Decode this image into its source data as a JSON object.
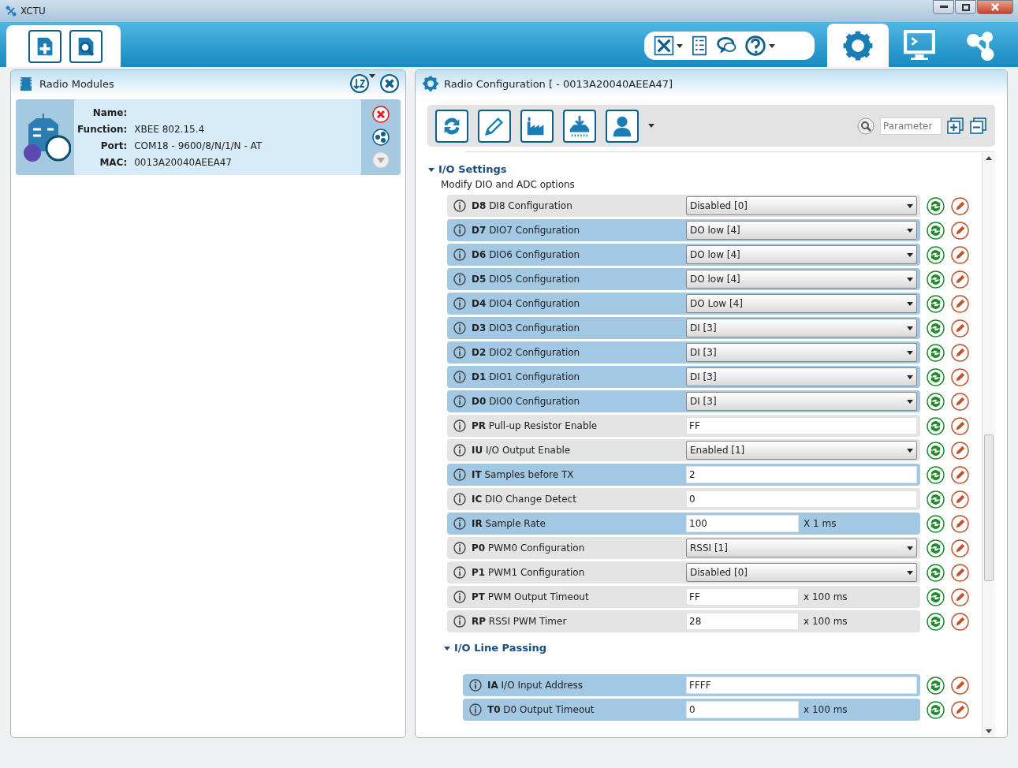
{
  "window": {
    "title": "XCTU"
  },
  "view_tabs": [
    {
      "kind": "configuration",
      "selected": true
    },
    {
      "kind": "consoles",
      "selected": false
    },
    {
      "kind": "network",
      "selected": false
    }
  ],
  "radio_modules": {
    "title": "Radio Modules",
    "module": {
      "fields": [
        {
          "label": "Name:"
        },
        {
          "label": "Function:",
          "value": "XBEE 802.15.4"
        },
        {
          "label": "Port:",
          "value": "COM18 - 9600/8/N/1/N - AT"
        },
        {
          "label": "MAC:",
          "value": "0013A20040AEEA47"
        }
      ]
    }
  },
  "radio_configuration": {
    "title": "Radio Configuration [  - 0013A20040AEEA47]",
    "search": {
      "placeholder": "Parameter"
    },
    "sections": [
      {
        "title": "I/O Settings",
        "expanded": true,
        "description": "Modify DIO and ADC options",
        "rows": [
          {
            "label": "**D8** DI8 Configuration",
            "kind": "dropdown",
            "value": "Disabled [0]",
            "changed": false
          },
          {
            "label": "**D7** DIO7 Configuration",
            "kind": "dropdown",
            "value": "DO low [4]",
            "changed": true
          },
          {
            "label": "**D6** DIO6 Configuration",
            "kind": "dropdown",
            "value": "DO low [4]",
            "changed": true
          },
          {
            "label": "**D5** DIO5 Configuration",
            "kind": "dropdown",
            "value": "DO low [4]",
            "changed": true
          },
          {
            "label": "**D4** DIO4 Configuration",
            "kind": "dropdown",
            "value": "DO Low [4]",
            "changed": true
          },
          {
            "label": "**D3** DIO3 Configuration",
            "kind": "dropdown",
            "value": "DI [3]",
            "changed": true
          },
          {
            "label": "**D2** DIO2 Configuration",
            "kind": "dropdown",
            "value": "DI [3]",
            "changed": true
          },
          {
            "label": "**D1** DIO1 Configuration",
            "kind": "dropdown",
            "value": "DI [3]",
            "changed": true
          },
          {
            "label": "**D0** DIO0 Configuration",
            "kind": "dropdown",
            "value": "DI [3]",
            "changed": true
          },
          {
            "label": "**PR** Pull-up Resistor Enable",
            "kind": "text",
            "value": "FF",
            "changed": false
          },
          {
            "label": "**IU** I/O Output Enable",
            "kind": "dropdown",
            "value": "Enabled [1]",
            "changed": false
          },
          {
            "label": "**IT** Samples before TX",
            "kind": "text",
            "value": "2",
            "changed": true
          },
          {
            "label": "**IC** DIO Change Detect",
            "kind": "text",
            "value": "0",
            "changed": false
          },
          {
            "label": "**IR** Sample Rate",
            "kind": "text",
            "value": "100",
            "unit": "X 1 ms",
            "changed": true
          },
          {
            "label": "**P0** PWM0 Configuration",
            "kind": "dropdown",
            "value": "RSSI [1]",
            "changed": false
          },
          {
            "label": "**P1** PWM1 Configuration",
            "kind": "dropdown",
            "value": "Disabled [0]",
            "changed": false
          },
          {
            "label": "**PT** PWM Output Timeout",
            "kind": "text",
            "value": "FF",
            "unit": "x 100 ms",
            "changed": false
          },
          {
            "label": "**RP** RSSI PWM Timer",
            "kind": "text",
            "value": "28",
            "unit": "x 100 ms",
            "changed": false
          }
        ]
      },
      {
        "title": "I/O Line Passing",
        "expanded": true,
        "rows": [
          {
            "label": "**IA** I/O Input Address",
            "kind": "text",
            "value": "FFFF",
            "changed": true
          },
          {
            "label": "**T0** D0 Output Timeout",
            "kind": "text",
            "value": "0",
            "unit": "x 100 ms",
            "changed": true
          }
        ]
      }
    ]
  }
}
